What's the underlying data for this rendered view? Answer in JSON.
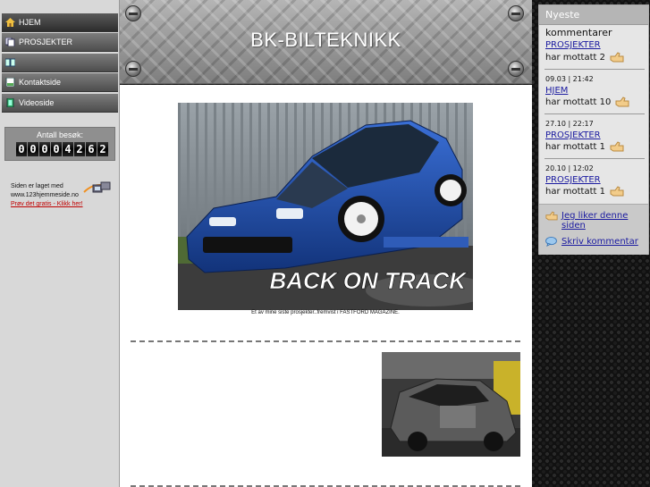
{
  "nav": {
    "items": [
      {
        "label": "HJEM",
        "icon": "home-icon"
      },
      {
        "label": "PROSJEKTER",
        "icon": "pages-icon"
      },
      {
        "label": "",
        "icon": "book-icon"
      },
      {
        "label": "Kontaktside",
        "icon": "contact-page-icon"
      },
      {
        "label": "Videoside",
        "icon": "film-icon"
      }
    ]
  },
  "counter": {
    "label": "Antall besøk:",
    "digits": [
      "0",
      "0",
      "0",
      "0",
      "4",
      "2",
      "6",
      "2"
    ]
  },
  "made_with": {
    "line1": "Siden er laget med",
    "line2": "www.123hjemmeside.no",
    "link": "Prøv det gratis - Klikk her!"
  },
  "header": {
    "title": "BK-BILTEKNIKK"
  },
  "content": {
    "photo_headline": "BACK ON TRACK",
    "caption": "Et av mine siste prosjekter..fremvist i FASTFORD MAGAZINE."
  },
  "comments": {
    "title": "Nyeste",
    "title2": "kommentarer",
    "items": [
      {
        "date": "",
        "link": "PROSJEKTER",
        "text": "har mottatt 2"
      },
      {
        "date": "09.03 | 21:42",
        "link": "HJEM",
        "text": "har mottatt 10"
      },
      {
        "date": "27.10 | 22:17",
        "link": "PROSJEKTER",
        "text": "har mottatt 1"
      },
      {
        "date": "20.10 | 12:02",
        "link": "PROSJEKTER",
        "text": "har mottatt 1"
      }
    ],
    "like": "Jeg liker denne siden",
    "write": "Skriv kommentar"
  },
  "colors": {
    "nav_bg": "#5a5a5a",
    "link": "#1a1aa0",
    "car_blue": "#1d4fb0"
  }
}
